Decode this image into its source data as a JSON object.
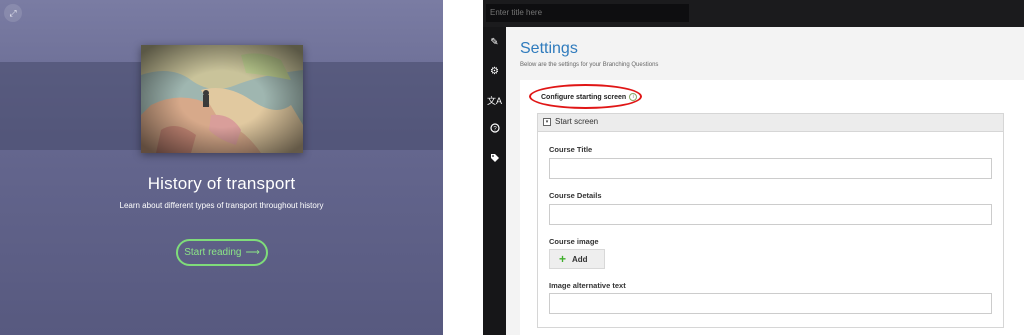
{
  "left_preview": {
    "title": "History of transport",
    "subtitle": "Learn about different types of transport throughout history",
    "start_button": "Start reading",
    "start_arrow": "⟶",
    "fullscreen_icon": "expand-icon",
    "accent_color": "#7fdc7a"
  },
  "editor": {
    "title_placeholder": "Enter title here",
    "sidebar_icons": [
      "pencil-icon",
      "gear-icon",
      "translate-icon",
      "help-icon",
      "tag-icon"
    ],
    "settings_title": "Settings",
    "settings_description": "Below are the settings for your Branching Questions",
    "configure_label": "Configure starting screen",
    "group_toggle": "▾",
    "group_title": "Start screen",
    "fields": {
      "course_title": "Course Title",
      "course_details": "Course Details",
      "course_image": "Course image",
      "add_button": "Add",
      "image_alt": "Image alternative text"
    },
    "colors": {
      "heading": "#2f7bbd",
      "highlight": "#e01616",
      "add_plus": "#3fae2b"
    }
  }
}
